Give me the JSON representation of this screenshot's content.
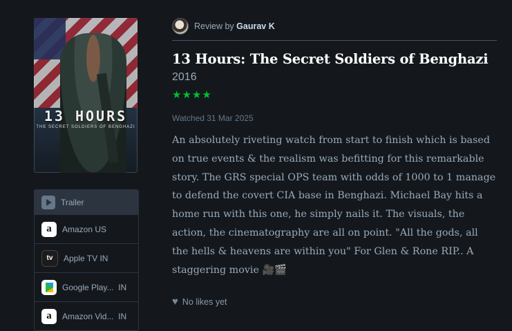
{
  "poster": {
    "title": "13 HOURS",
    "subtitle": "THE SECRET SOLDIERS OF BENGHAZI"
  },
  "services": {
    "trailer_label": "Trailer",
    "items": [
      {
        "name": "Amazon US",
        "icon": "amazon-icon"
      },
      {
        "name": "Apple TV IN",
        "icon": "apple-tv-icon"
      },
      {
        "name": "Google Play...  IN",
        "icon": "google-play-icon"
      },
      {
        "name": "Amazon Vid...  IN",
        "icon": "amazon-icon"
      }
    ]
  },
  "review": {
    "by_prefix": "Review by",
    "reviewer": "Gaurav K",
    "film_title": "13 Hours: The Secret Soldiers of Benghazi",
    "year": "2016",
    "stars": "★★★★",
    "rating_value": 4,
    "watched": "Watched 31 Mar 2025",
    "text": "An absolutely riveting watch from start to finish which is based on true events & the realism was befitting for this remarkable story. The GRS special OPS team with odds of 1000 to 1 manage to defend the covert CIA base in Benghazi. Michael Bay hits a home run with this one, he simply nails it. The visuals, the action, the cinematography are all on point. \"All the gods, all the hells & heavens are within you\" For Glen & Rone RIP.. A staggering movie 🎥🎬",
    "likes": "No likes yet"
  },
  "colors": {
    "background": "#14181c",
    "star_green": "#00c030",
    "title_white": "#ffffff",
    "muted_text": "#9aabbb"
  }
}
